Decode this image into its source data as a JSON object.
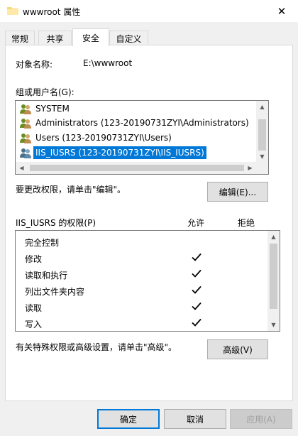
{
  "window": {
    "title": "wwwroot 属性",
    "close_glyph": "✕"
  },
  "tabs": [
    {
      "label": "常规",
      "active": false
    },
    {
      "label": "共享",
      "active": false
    },
    {
      "label": "安全",
      "active": true
    },
    {
      "label": "自定义",
      "active": false
    }
  ],
  "object_name": {
    "label": "对象名称:",
    "value": "E:\\wwwroot"
  },
  "group_list": {
    "label": "组或用户名(G):",
    "items": [
      {
        "name": "SYSTEM",
        "selected": false
      },
      {
        "name": "Administrators (123-20190731ZYI\\Administrators)",
        "selected": false
      },
      {
        "name": "Users (123-20190731ZYI\\Users)",
        "selected": false
      },
      {
        "name": "IIS_IUSRS (123-20190731ZYI\\IIS_IUSRS)",
        "selected": true
      }
    ]
  },
  "change_hint": "要更改权限，请单击\"编辑\"。",
  "edit_button": "编辑(E)...",
  "permissions": {
    "label": "IIS_IUSRS 的权限(P)",
    "allow_header": "允许",
    "deny_header": "拒绝",
    "rows": [
      {
        "name": "完全控制",
        "allow": false,
        "deny": false
      },
      {
        "name": "修改",
        "allow": true,
        "deny": false
      },
      {
        "name": "读取和执行",
        "allow": true,
        "deny": false
      },
      {
        "name": "列出文件夹内容",
        "allow": true,
        "deny": false
      },
      {
        "name": "读取",
        "allow": true,
        "deny": false
      },
      {
        "name": "写入",
        "allow": true,
        "deny": false
      }
    ]
  },
  "advanced_hint": "有关特殊权限或高级设置，请单击\"高级\"。",
  "advanced_button": "高级(V)",
  "footer": {
    "ok": "确定",
    "cancel": "取消",
    "apply": "应用(A)"
  },
  "colors": {
    "selection": "#0078d7",
    "default_button_border": "#0078d7"
  }
}
